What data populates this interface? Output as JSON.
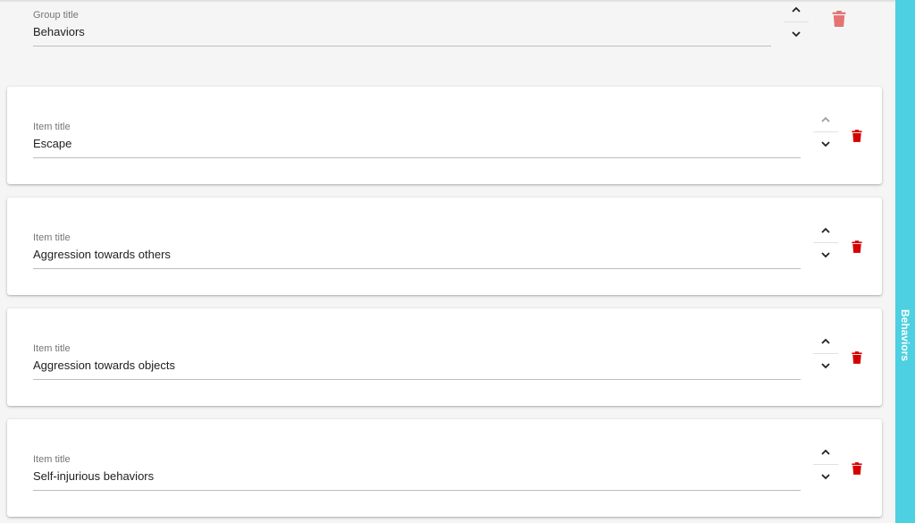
{
  "group": {
    "label": "Group title",
    "value": "Behaviors"
  },
  "items": [
    {
      "label": "Item title",
      "value": "Escape"
    },
    {
      "label": "Item title",
      "value": "Aggression towards others"
    },
    {
      "label": "Item title",
      "value": "Aggression towards objects"
    },
    {
      "label": "Item title",
      "value": "Self-injurious behaviors"
    }
  ],
  "sidebar": {
    "label": "Behaviors"
  },
  "icons": {
    "move_up": "chevron-up-icon",
    "move_down": "chevron-down-icon",
    "delete": "trash-icon"
  },
  "colors": {
    "sidebar": "#4dd0e1",
    "delete": "#d50000",
    "delete_group": "#e57373"
  }
}
